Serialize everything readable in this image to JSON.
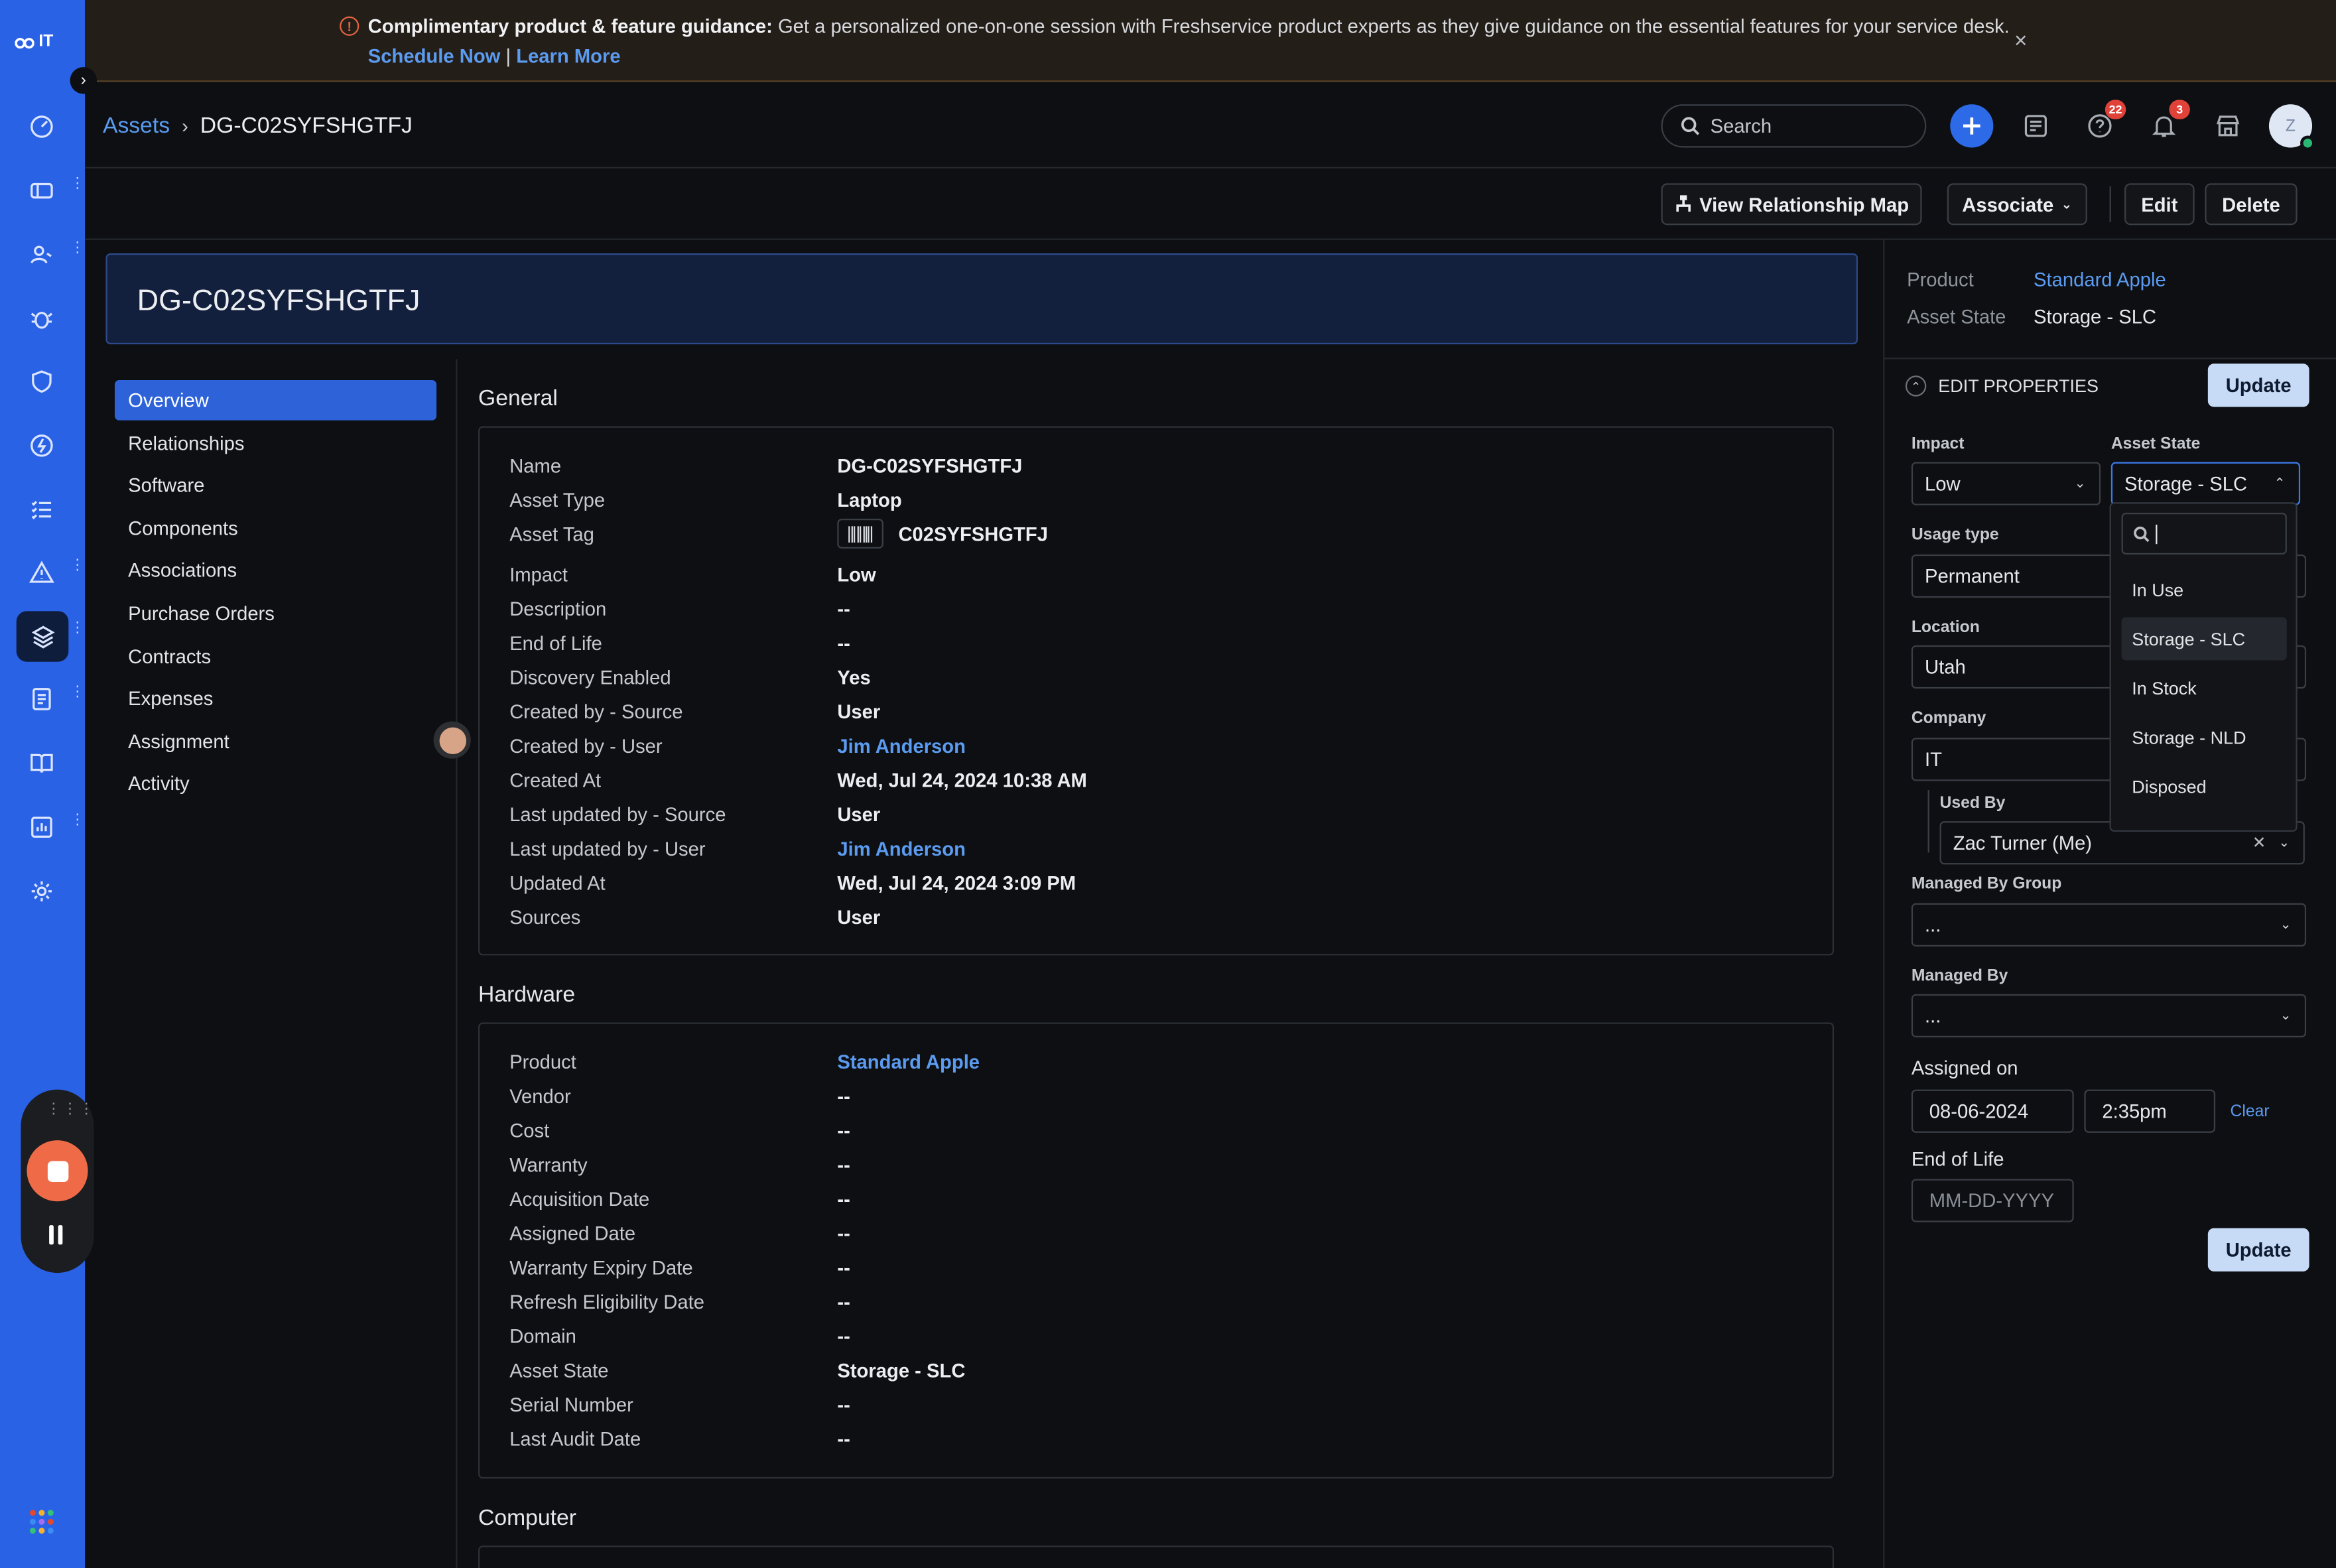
{
  "app": {
    "logo_text": "IT"
  },
  "banner": {
    "bold_text": "Complimentary product & feature guidance:",
    "text": " Get a personalized one-on-one session with Freshservice product experts as they give guidance on the essential features for your service desk.",
    "schedule_label": "Schedule Now",
    "separator": " | ",
    "learn_label": "Learn More",
    "close_glyph": "×"
  },
  "header": {
    "breadcrumb_root": "Assets",
    "breadcrumb_sep": "›",
    "breadcrumb_current": "DG-C02SYFSHGTFJ",
    "search_placeholder": "Search",
    "help_badge": "22",
    "notif_badge": "3",
    "avatar_initial": "Z"
  },
  "actions": {
    "relationship_map": "View Relationship Map",
    "associate": "Associate",
    "edit": "Edit",
    "delete": "Delete"
  },
  "title": "DG-C02SYFSHGTFJ",
  "nav": [
    "Overview",
    "Relationships",
    "Software",
    "Components",
    "Associations",
    "Purchase Orders",
    "Contracts",
    "Expenses",
    "Assignment",
    "Activity"
  ],
  "general": {
    "title": "General",
    "rows": [
      {
        "k": "Name",
        "v": "DG-C02SYFSHGTFJ"
      },
      {
        "k": "Asset Type",
        "v": "Laptop"
      },
      {
        "k": "Asset Tag",
        "v": "C02SYFSHGTFJ"
      },
      {
        "k": "Impact",
        "v": "Low"
      },
      {
        "k": "Description",
        "v": "--"
      },
      {
        "k": "End of Life",
        "v": "--"
      },
      {
        "k": "Discovery Enabled",
        "v": "Yes"
      },
      {
        "k": "Created by - Source",
        "v": "User"
      },
      {
        "k": "Created by - User",
        "v": "Jim Anderson"
      },
      {
        "k": "Created At",
        "v": "Wed, Jul 24, 2024 10:38 AM"
      },
      {
        "k": "Last updated by - Source",
        "v": "User"
      },
      {
        "k": "Last updated by - User",
        "v": "Jim Anderson"
      },
      {
        "k": "Updated At",
        "v": "Wed, Jul 24, 2024 3:09 PM"
      },
      {
        "k": "Sources",
        "v": "User"
      }
    ]
  },
  "hardware": {
    "title": "Hardware",
    "rows": [
      {
        "k": "Product",
        "v": "Standard Apple"
      },
      {
        "k": "Vendor",
        "v": "--"
      },
      {
        "k": "Cost",
        "v": "--"
      },
      {
        "k": "Warranty",
        "v": "--"
      },
      {
        "k": "Acquisition Date",
        "v": "--"
      },
      {
        "k": "Assigned Date",
        "v": "--"
      },
      {
        "k": "Warranty Expiry Date",
        "v": "--"
      },
      {
        "k": "Refresh Eligibility Date",
        "v": "--"
      },
      {
        "k": "Domain",
        "v": "--"
      },
      {
        "k": "Asset State",
        "v": "Storage - SLC"
      },
      {
        "k": "Serial Number",
        "v": "--"
      },
      {
        "k": "Last Audit Date",
        "v": "--"
      }
    ]
  },
  "computer": {
    "title": "Computer"
  },
  "panel": {
    "product_label": "Product",
    "product_value": "Standard Apple",
    "state_label": "Asset State",
    "state_value": "Storage - SLC",
    "edit_title": "EDIT PROPERTIES",
    "update_label": "Update",
    "impact_label": "Impact",
    "impact_value": "Low",
    "asset_state_label": "Asset State",
    "asset_state_value": "Storage - SLC",
    "usage_label": "Usage type",
    "usage_value": "Permanent",
    "location_label": "Location",
    "location_value": "Utah",
    "company_label": "Company",
    "company_value": "IT",
    "used_by_label": "Used By",
    "used_by_value": "Zac Turner (Me)",
    "managed_group_label": "Managed By Group",
    "managed_group_value": "...",
    "managed_by_label": "Managed By",
    "managed_by_value": "...",
    "assigned_on_label": "Assigned on",
    "assigned_date": "08-06-2024",
    "assigned_time": "2:35pm",
    "clear_label": "Clear",
    "eol_label": "End of Life",
    "eol_placeholder": "MM-DD-YYYY"
  },
  "dropdown": {
    "options": [
      "In Use",
      "Storage - SLC",
      "In Stock",
      "Storage - NLD",
      "Disposed"
    ],
    "selected": "Storage - SLC"
  },
  "colors": {
    "rail": "#2a62e6",
    "accent": "#2d6ae8",
    "link": "#5b9bf0",
    "badge": "#e0423a",
    "record": "#ef6b48"
  }
}
